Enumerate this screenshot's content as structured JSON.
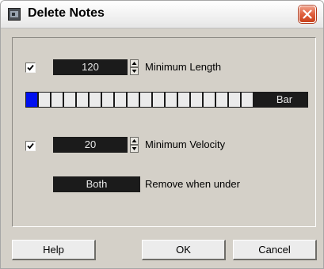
{
  "window": {
    "title": "Delete Notes",
    "icon": "app-icon",
    "close_icon": "close-icon"
  },
  "min_length": {
    "checked": true,
    "value": "120",
    "label": "Minimum Length"
  },
  "length_bar": {
    "segments": 16,
    "active_segments": 1,
    "unit_label": "Bar",
    "active_color": "#0010f0"
  },
  "min_velocity": {
    "checked": true,
    "value": "20",
    "label": "Minimum Velocity"
  },
  "remove_mode": {
    "value": "Both",
    "label": "Remove when under"
  },
  "buttons": {
    "help": "Help",
    "ok": "OK",
    "cancel": "Cancel"
  }
}
